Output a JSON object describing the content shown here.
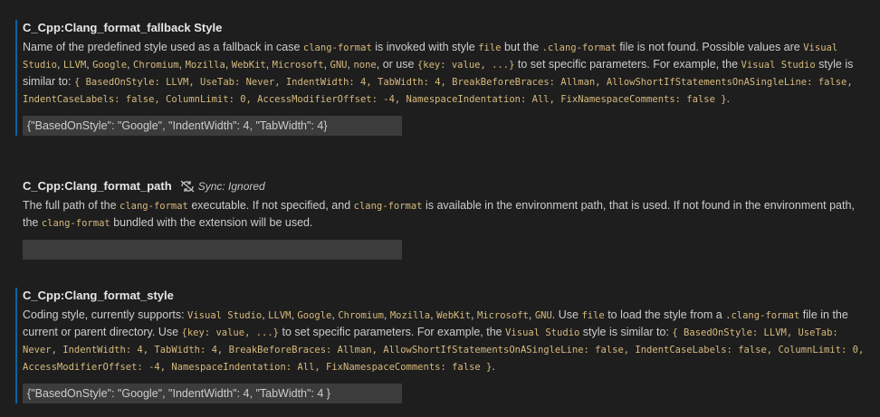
{
  "settings": [
    {
      "category": "C_Cpp: ",
      "name": "Clang_format_fallback Style",
      "description_segments": [
        {
          "t": "Name of the predefined style used as a fallback in case ",
          "code": false
        },
        {
          "t": "clang-format",
          "code": true
        },
        {
          "t": " is invoked with style ",
          "code": false
        },
        {
          "t": "file",
          "code": true
        },
        {
          "t": " but the ",
          "code": false
        },
        {
          "t": ".clang-format",
          "code": true
        },
        {
          "t": " file is not found. Possible values are ",
          "code": false
        },
        {
          "t": "Visual Studio",
          "code": true
        },
        {
          "t": ", ",
          "code": false
        },
        {
          "t": "LLVM",
          "code": true
        },
        {
          "t": ", ",
          "code": false
        },
        {
          "t": "Google",
          "code": true
        },
        {
          "t": ", ",
          "code": false
        },
        {
          "t": "Chromium",
          "code": true
        },
        {
          "t": ", ",
          "code": false
        },
        {
          "t": "Mozilla",
          "code": true
        },
        {
          "t": ", ",
          "code": false
        },
        {
          "t": "WebKit",
          "code": true
        },
        {
          "t": ", ",
          "code": false
        },
        {
          "t": "Microsoft",
          "code": true
        },
        {
          "t": ", ",
          "code": false
        },
        {
          "t": "GNU",
          "code": true
        },
        {
          "t": ", ",
          "code": false
        },
        {
          "t": "none",
          "code": true
        },
        {
          "t": ", or use ",
          "code": false
        },
        {
          "t": "{key: value, ...}",
          "code": true
        },
        {
          "t": " to set specific parameters. For example, the ",
          "code": false
        },
        {
          "t": "Visual Studio",
          "code": true
        },
        {
          "t": " style is similar to: ",
          "code": false
        },
        {
          "t": "{ BasedOnStyle: LLVM, UseTab: Never, IndentWidth: 4, TabWidth: 4, BreakBeforeBraces: Allman, AllowShortIfStatementsOnASingleLine: false, IndentCaseLabels: false, ColumnLimit: 0, AccessModifierOffset: -4, NamespaceIndentation: All, FixNamespaceComments: false }",
          "code": true
        },
        {
          "t": ".",
          "code": false
        }
      ],
      "value": "{\"BasedOnStyle\": \"Google\", \"IndentWidth\": 4, \"TabWidth\": 4}",
      "sync": null
    },
    {
      "category": "C_Cpp: ",
      "name": "Clang_format_path",
      "description_segments": [
        {
          "t": "The full path of the ",
          "code": false
        },
        {
          "t": "clang-format",
          "code": true
        },
        {
          "t": " executable. If not specified, and ",
          "code": false
        },
        {
          "t": "clang-format",
          "code": true
        },
        {
          "t": " is available in the environment path, that is used. If not found in the environment path, the ",
          "code": false
        },
        {
          "t": "clang-format",
          "code": true
        },
        {
          "t": " bundled with the extension will be used.",
          "code": false
        }
      ],
      "value": "",
      "sync": "Sync: Ignored"
    },
    {
      "category": "C_Cpp: ",
      "name": "Clang_format_style",
      "description_segments": [
        {
          "t": "Coding style, currently supports: ",
          "code": false
        },
        {
          "t": "Visual Studio",
          "code": true
        },
        {
          "t": ", ",
          "code": false
        },
        {
          "t": "LLVM",
          "code": true
        },
        {
          "t": ", ",
          "code": false
        },
        {
          "t": "Google",
          "code": true
        },
        {
          "t": ", ",
          "code": false
        },
        {
          "t": "Chromium",
          "code": true
        },
        {
          "t": ", ",
          "code": false
        },
        {
          "t": "Mozilla",
          "code": true
        },
        {
          "t": ", ",
          "code": false
        },
        {
          "t": "WebKit",
          "code": true
        },
        {
          "t": ", ",
          "code": false
        },
        {
          "t": "Microsoft",
          "code": true
        },
        {
          "t": ", ",
          "code": false
        },
        {
          "t": "GNU",
          "code": true
        },
        {
          "t": ". Use ",
          "code": false
        },
        {
          "t": "file",
          "code": true
        },
        {
          "t": " to load the style from a ",
          "code": false
        },
        {
          "t": ".clang-format",
          "code": true
        },
        {
          "t": " file in the current or parent directory. Use ",
          "code": false
        },
        {
          "t": "{key: value, ...}",
          "code": true
        },
        {
          "t": " to set specific parameters. For example, the ",
          "code": false
        },
        {
          "t": "Visual Studio",
          "code": true
        },
        {
          "t": " style is similar to: ",
          "code": false
        },
        {
          "t": "{ BasedOnStyle: LLVM, UseTab: Never, IndentWidth: 4, TabWidth: 4, BreakBeforeBraces: Allman, AllowShortIfStatementsOnASingleLine: false, IndentCaseLabels: false, ColumnLimit: 0, AccessModifierOffset: -4, NamespaceIndentation: All, FixNamespaceComments: false }",
          "code": true
        },
        {
          "t": ".",
          "code": false
        }
      ],
      "value": "{\"BasedOnStyle\": \"Google\", \"IndentWidth\": 4, \"TabWidth\": 4 }",
      "sync": null
    }
  ],
  "colors": {
    "background": "#1e1e1e",
    "focus_border": "#0e639c",
    "code_text": "#d7ba7d",
    "input_background": "#3c3c3c"
  },
  "icons": {
    "sync": "sync-ignored-icon"
  }
}
